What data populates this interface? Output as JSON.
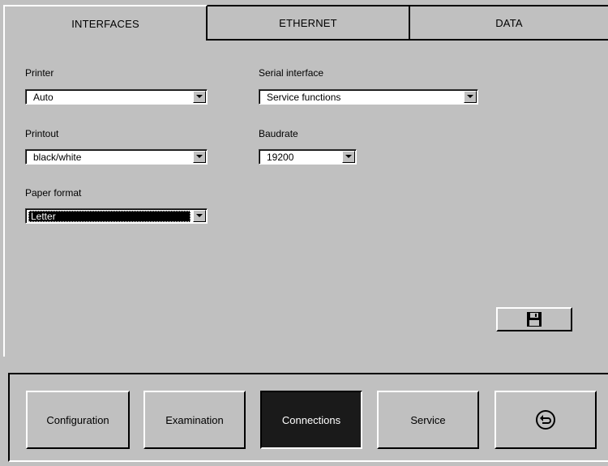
{
  "tabs": [
    {
      "label": "INTERFACES",
      "active": true
    },
    {
      "label": "ETHERNET",
      "active": false
    },
    {
      "label": "DATA",
      "active": false
    }
  ],
  "fields": {
    "printer": {
      "label": "Printer",
      "value": "Auto"
    },
    "printout": {
      "label": "Printout",
      "value": "black/white"
    },
    "paper_format": {
      "label": "Paper format",
      "value": "Letter"
    },
    "serial_interface": {
      "label": "Serial interface",
      "value": "Service functions"
    },
    "baudrate": {
      "label": "Baudrate",
      "value": "19200"
    }
  },
  "save_button": {
    "icon": "floppy-disk-icon"
  },
  "nav": [
    {
      "label": "Configuration",
      "active": false
    },
    {
      "label": "Examination",
      "active": false
    },
    {
      "label": "Connections",
      "active": true
    },
    {
      "label": "Service",
      "active": false
    },
    {
      "icon": "back-arrow-icon"
    }
  ],
  "colors": {
    "background": "#c0c0c0",
    "active_nav": "#1a1a1a",
    "field": "#ffffff"
  }
}
